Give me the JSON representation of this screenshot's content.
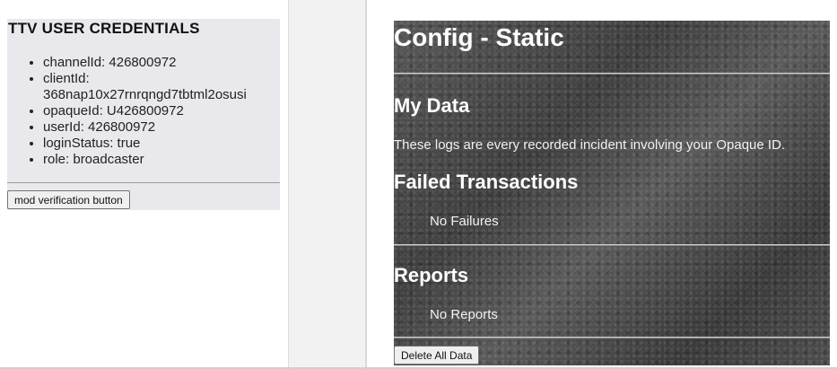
{
  "credentials": {
    "title": "TTV USER CREDENTIALS",
    "items": [
      "channelId: 426800972",
      "clientId: 368nap10x27rnrqngd7tbtml2osusi",
      "opaqueId: U426800972",
      "userId: 426800972",
      "loginStatus: true",
      "role: broadcaster"
    ],
    "mod_button_label": "mod verification button"
  },
  "config": {
    "title": "Config - Static",
    "my_data_heading": "My Data",
    "logs_text": "These logs are every recorded incident involving your Opaque ID.",
    "failed_heading": "Failed Transactions",
    "failed_text": "No Failures",
    "reports_heading": "Reports",
    "reports_text": "No Reports",
    "delete_button_label": "Delete All Data"
  },
  "colors": {
    "panel_bg": "#e9e8ed",
    "config_bg": "#4b4b4b",
    "config_text": "#ffffff"
  }
}
